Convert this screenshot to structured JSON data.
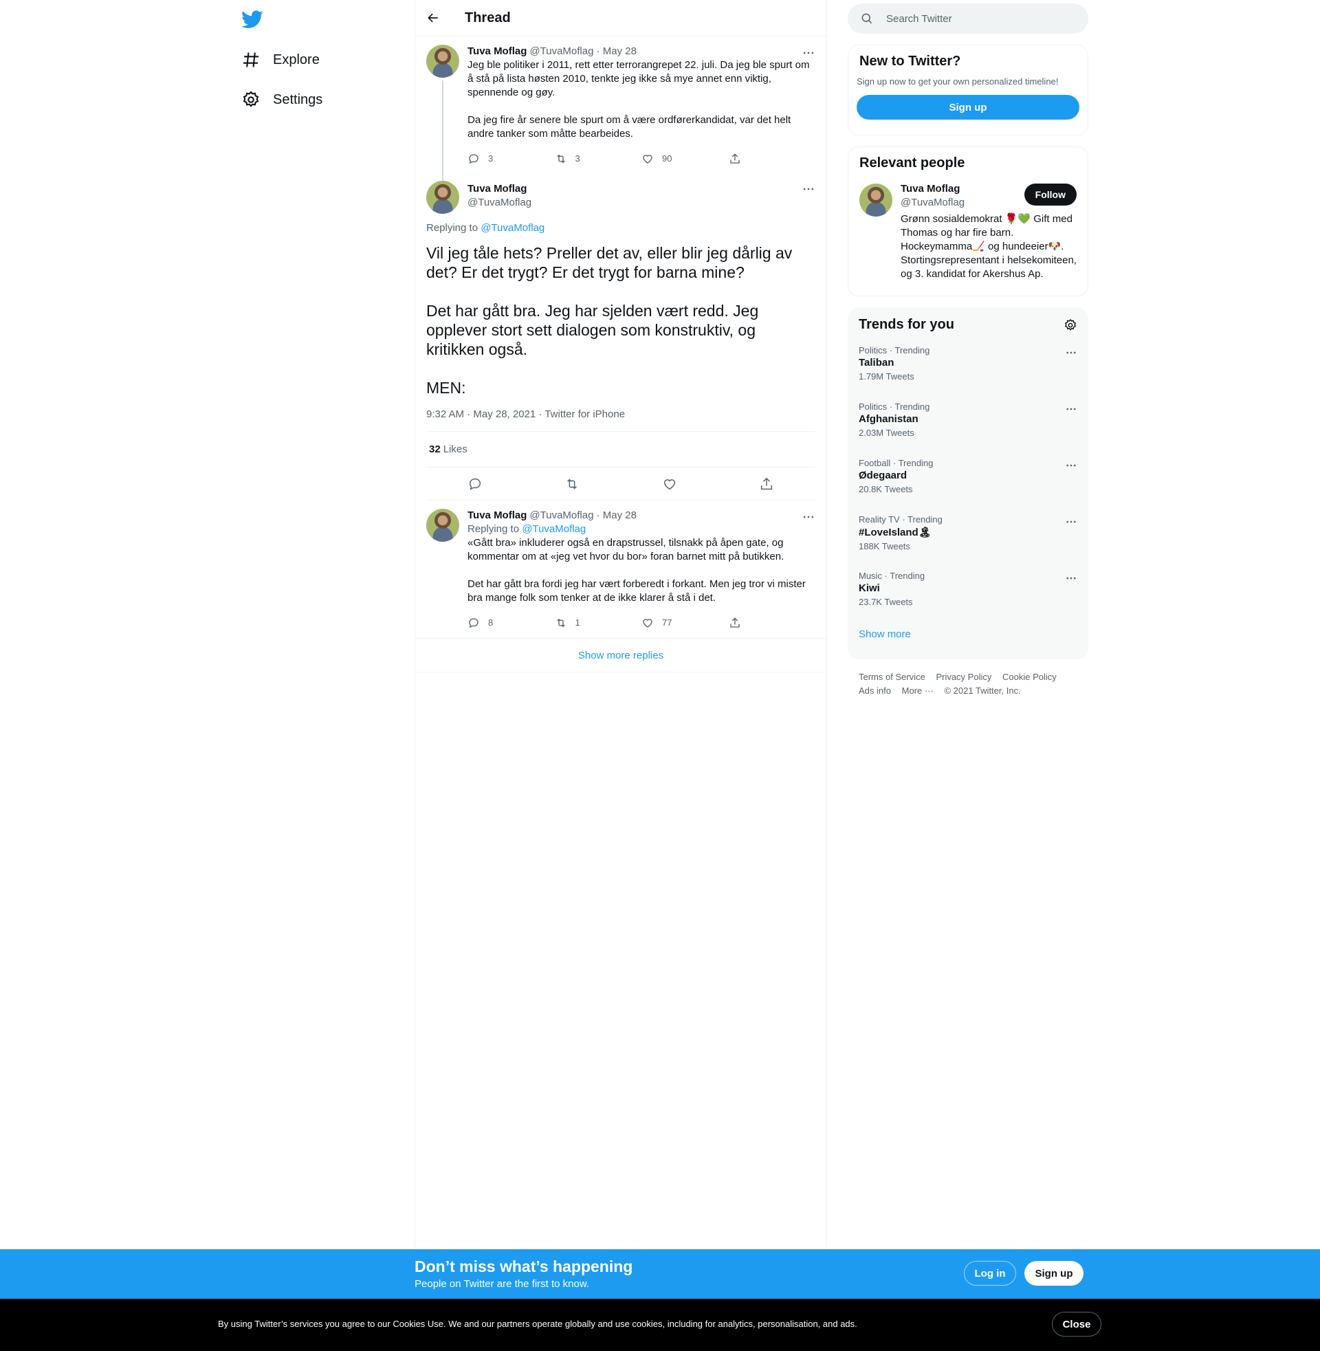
{
  "nav": {
    "items": [
      {
        "label": "Explore",
        "icon": "hashtag-icon"
      },
      {
        "label": "Settings",
        "icon": "gear-icon"
      }
    ]
  },
  "header": {
    "title": "Thread"
  },
  "tweet1": {
    "name": "Tuva Moflag",
    "meta": "@TuvaMoflag · May 28",
    "text": "Jeg ble politiker i 2011, rett etter terrorangrepet 22. juli. Da jeg ble spurt om å stå på lista høsten 2010, tenkte jeg ikke så mye annet enn viktig, spennende og gøy.\n\nDa jeg fire år senere ble spurt om å være ordførerkandidat, var det helt andre tanker som måtte bearbeides.",
    "replies": "3",
    "retweets": "3",
    "likes": "90"
  },
  "focus": {
    "name": "Tuva Moflag",
    "handle": "@TuvaMoflag",
    "replying_prefix": "Replying to",
    "replying_to": "@TuvaMoflag",
    "text": "Vil jeg tåle hets? Preller det av, eller blir jeg dårlig av det? Er det trygt? Er det trygt for barna mine?\n\nDet har gått bra. Jeg har sjelden vært redd. Jeg opplever stort sett dialogen som konstruktiv, og kritikken også.\n\nMEN:",
    "timestamp": "9:32 AM · May 28, 2021 · Twitter for iPhone",
    "likes_count": "32",
    "likes_label": "Likes"
  },
  "tweet3": {
    "name": "Tuva Moflag",
    "meta": "@TuvaMoflag · May 28",
    "replying_prefix": "Replying to",
    "replying_to": "@TuvaMoflag",
    "text": "«Gått bra» inkluderer også en drapstrussel, tilsnakk på åpen gate, og kommentar om at «jeg vet hvor du bor» foran barnet mitt på butikken.\n\nDet har gått bra fordi jeg har vært forberedt i forkant. Men jeg tror vi mister bra mange folk som tenker at de ikke klarer å stå i det.",
    "replies": "8",
    "retweets": "1",
    "likes": "77"
  },
  "show_more_replies": "Show more replies",
  "search": {
    "placeholder": "Search Twitter"
  },
  "new_to_twitter": {
    "title": "New to Twitter?",
    "subtitle": "Sign up now to get your own personalized timeline!",
    "button": "Sign up"
  },
  "relevant": {
    "title": "Relevant people",
    "name": "Tuva Moflag",
    "handle": "@TuvaMoflag",
    "follow": "Follow",
    "bio": "Grønn sosialdemokrat 🌹💚 Gift med Thomas og har fire barn. Hockeymamma🏒 og hundeeier🐶. Stortingsrepresentant i helsekomiteen, og 3. kandidat for Akershus Ap."
  },
  "trends": {
    "title": "Trends for you",
    "items": [
      {
        "category": "Politics · Trending",
        "name": "Taliban",
        "count": "1.79M Tweets"
      },
      {
        "category": "Politics · Trending",
        "name": "Afghanistan",
        "count": "2.03M Tweets"
      },
      {
        "category": "Football · Trending",
        "name": "Ødegaard",
        "count": "20.8K Tweets"
      },
      {
        "category": "Reality TV · Trending",
        "name": "#LoveIsland🏝",
        "count": "188K Tweets"
      },
      {
        "category": "Music · Trending",
        "name": "Kiwi",
        "count": "23.7K Tweets"
      }
    ],
    "show_more": "Show more"
  },
  "footer": {
    "links": [
      "Terms of Service",
      "Privacy Policy",
      "Cookie Policy",
      "Ads info",
      "More ···",
      "© 2021 Twitter, Inc."
    ]
  },
  "banner": {
    "headline": "Don’t miss what’s happening",
    "sub": "People on Twitter are the first to know.",
    "login": "Log in",
    "signup": "Sign up"
  },
  "cookies": {
    "text": "By using Twitter’s services you agree to our Cookies Use. We and our partners operate globally and use cookies, including for analytics, personalisation, and ads.",
    "close": "Close"
  }
}
